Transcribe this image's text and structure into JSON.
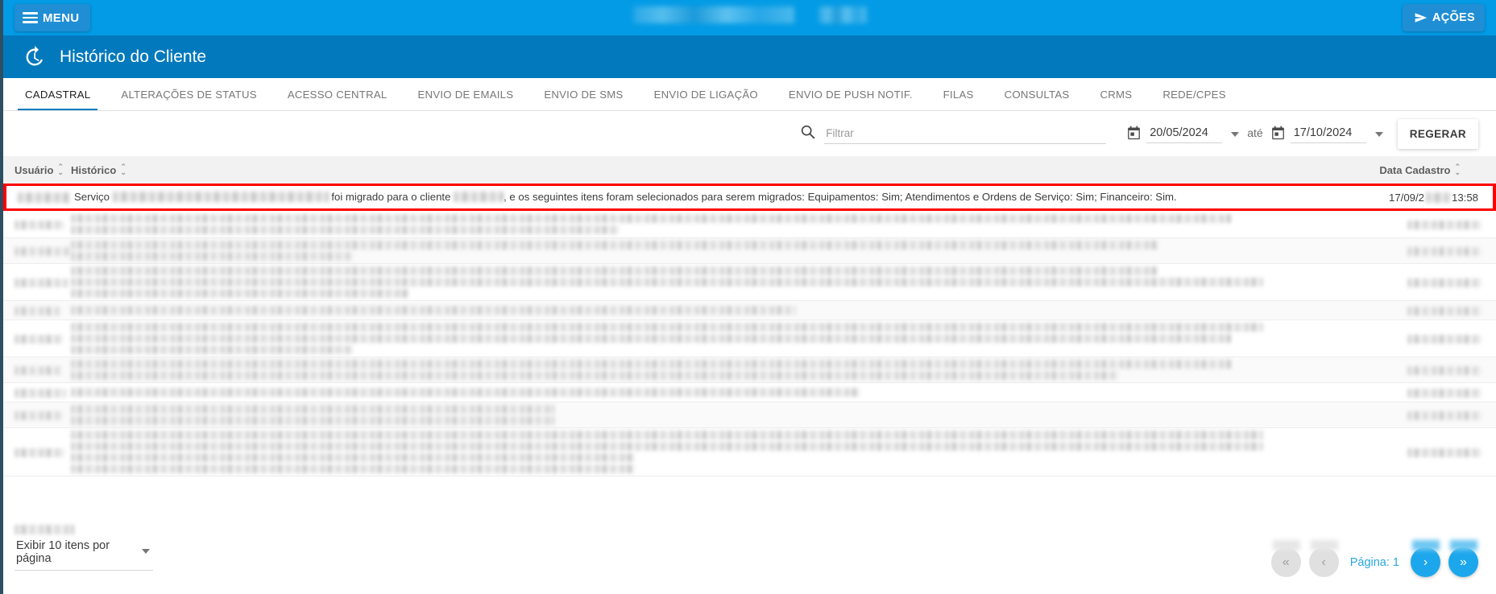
{
  "topbar": {
    "menu_label": "MENU",
    "menu_icon": "hamburger-icon",
    "actions_label": "AÇÕES",
    "actions_icon": "send-icon",
    "customer_name_redacted": true,
    "background_color": "#039be5",
    "button_color": "#1f8ed4"
  },
  "pagehead": {
    "title": "Histórico do Cliente",
    "icon": "history-clock-icon",
    "background_color": "#0279bd"
  },
  "tabs": {
    "active_index": 0,
    "accent_color": "#0279bd",
    "items": [
      {
        "label": "CADASTRAL"
      },
      {
        "label": "ALTERAÇÕES DE STATUS"
      },
      {
        "label": "ACESSO CENTRAL"
      },
      {
        "label": "ENVIO DE EMAILS"
      },
      {
        "label": "ENVIO DE SMS"
      },
      {
        "label": "ENVIO DE LIGAÇÃO"
      },
      {
        "label": "ENVIO DE PUSH NOTIF."
      },
      {
        "label": "FILAS"
      },
      {
        "label": "CONSULTAS"
      },
      {
        "label": "CRMS"
      },
      {
        "label": "REDE/CPES"
      }
    ]
  },
  "filterbar": {
    "search_icon": "search-icon",
    "search_value": "",
    "search_placeholder": "Filtrar",
    "date_from_icon": "calendar-icon",
    "date_from": "20/05/2024",
    "between_label": "até",
    "date_to_icon": "calendar-icon",
    "date_to": "17/10/2024",
    "regenerate_label": "REGERAR"
  },
  "table": {
    "columns": [
      {
        "key": "usuario",
        "label": "Usuário",
        "sortable": true
      },
      {
        "key": "historico",
        "label": "Histórico",
        "sortable": true
      },
      {
        "key": "data_cadastro",
        "label": "Data Cadastro",
        "sortable": true
      }
    ],
    "highlighted_row": {
      "highlight_color": "#fe0000",
      "usuario_redacted": true,
      "historico_prefix": "Serviço",
      "historico_mid": "foi migrado para o cliente",
      "historico_suffix": ", e os seguintes itens foram selecionados para serem migrados: Equipamentos: Sim; Atendimentos e Ordens de Serviço: Sim; Financeiro: Sim.",
      "data_cadastro_date": "17/09/2",
      "data_cadastro_time": "13:58"
    },
    "redacted_rows_count": 9
  },
  "footer": {
    "page_size_label": "Exibir 10 itens por página",
    "page_size_caret": "chevron-down-icon",
    "pager": {
      "first_icon": "«",
      "prev_icon": "‹",
      "page_label": "Página: 1",
      "next_icon": "›",
      "last_icon": "»",
      "first_enabled": false,
      "prev_enabled": false,
      "next_enabled": true,
      "last_enabled": true,
      "active_color": "#1ca7ec",
      "disabled_color": "#e0e0e0",
      "label_color": "#29a6e0"
    }
  }
}
